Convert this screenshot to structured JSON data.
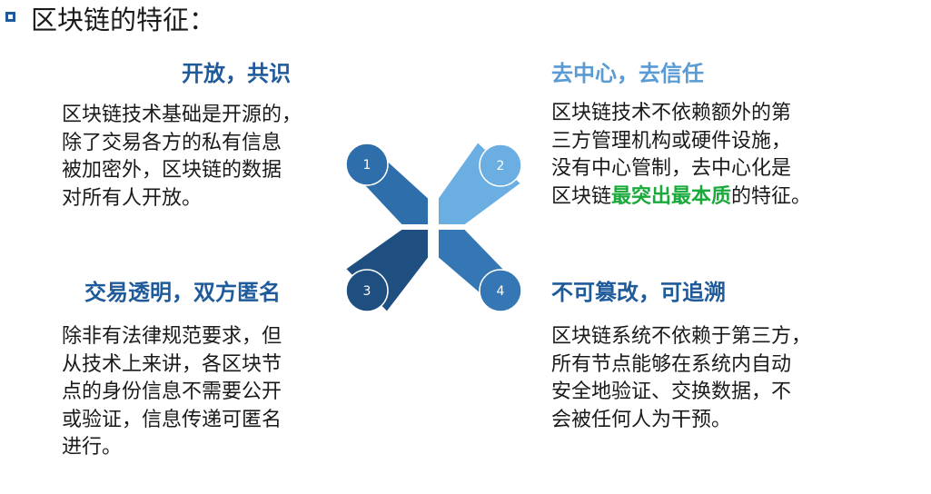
{
  "title": "区块链的特征：",
  "colors": {
    "petal_1": "#2e6fab",
    "petal_2": "#6aaee2",
    "petal_3": "#1e4f80",
    "petal_4": "#3577b5",
    "highlight": "#1aaa3c"
  },
  "cycle": {
    "numbers": [
      "1",
      "2",
      "3",
      "4"
    ]
  },
  "features": [
    {
      "heading": "开放，共识",
      "lines": [
        "区块链技术基础是开源的，",
        "除了交易各方的私有信息",
        "被加密外，区块链的数据",
        "对所有人开放。"
      ]
    },
    {
      "heading": "去中心，去信任",
      "lines": [
        "区块链技术不依赖额外的第",
        "三方管理机构或硬件设施，",
        "没有中心管制，去中心化是"
      ],
      "last_line_prefix": "区块链",
      "last_line_highlight": "最突出最本质",
      "last_line_suffix": "的特征。"
    },
    {
      "heading": "交易透明，双方匿名",
      "lines": [
        "除非有法律规范要求，但",
        "从技术上来讲，各区块节",
        "点的身份信息不需要公开",
        "或验证，信息传递可匿名",
        "进行。"
      ]
    },
    {
      "heading": "不可篡改，可追溯",
      "lines": [
        "区块链系统不依赖于第三方，",
        "所有节点能够在系统内自动",
        "安全地验证、交换数据，不",
        "会被任何人为干预。"
      ]
    }
  ]
}
